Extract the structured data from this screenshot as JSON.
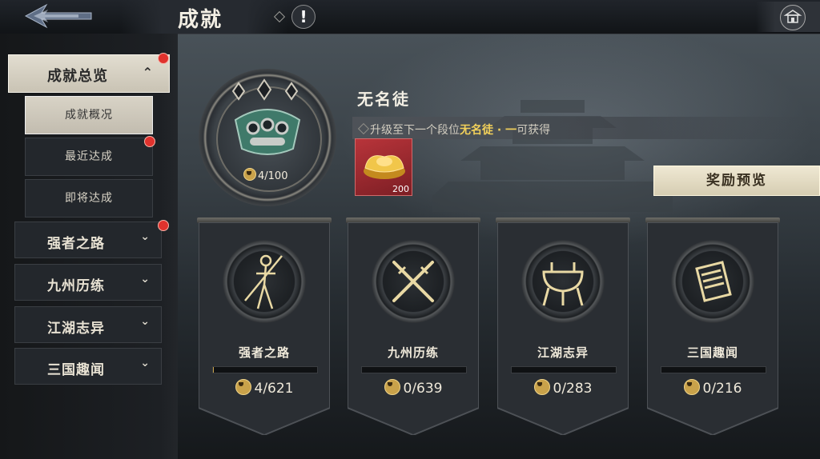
{
  "header": {
    "title": "成就",
    "help_glyph": "!"
  },
  "sidebar": {
    "overview": {
      "label": "成就总览",
      "expanded_glyph": "⌃"
    },
    "sub_items": [
      {
        "label": "成就概况",
        "active": true
      },
      {
        "label": "最近达成",
        "active": false
      },
      {
        "label": "即将达成",
        "active": false
      }
    ],
    "categories": [
      {
        "label": "强者之路",
        "chevron": "⌄"
      },
      {
        "label": "九州历练",
        "chevron": "⌄"
      },
      {
        "label": "江湖志异",
        "chevron": "⌄"
      },
      {
        "label": "三国趣闻",
        "chevron": "⌄"
      }
    ]
  },
  "rank": {
    "name": "无名徒",
    "progress": "4/100",
    "progress_value": 4,
    "progress_max": 100,
    "hint_prefix": "升级至下一个段位",
    "hint_highlight": "无名徒 · 一",
    "hint_suffix": "可获得",
    "reward_qty": "200",
    "preview_button": "奖励预览"
  },
  "banners": [
    {
      "name": "强者之路",
      "count": "4/621",
      "value": 4,
      "max": 621
    },
    {
      "name": "九州历练",
      "count": "0/639",
      "value": 0,
      "max": 639
    },
    {
      "name": "江湖志异",
      "count": "0/283",
      "value": 0,
      "max": 283
    },
    {
      "name": "三国趣闻",
      "count": "0/216",
      "value": 0,
      "max": 216
    }
  ],
  "colors": {
    "accent_gold": "#c9a24a",
    "highlight_yellow": "#f2d15a",
    "notice_red": "#e0322d",
    "reward_red": "#b8343a"
  }
}
